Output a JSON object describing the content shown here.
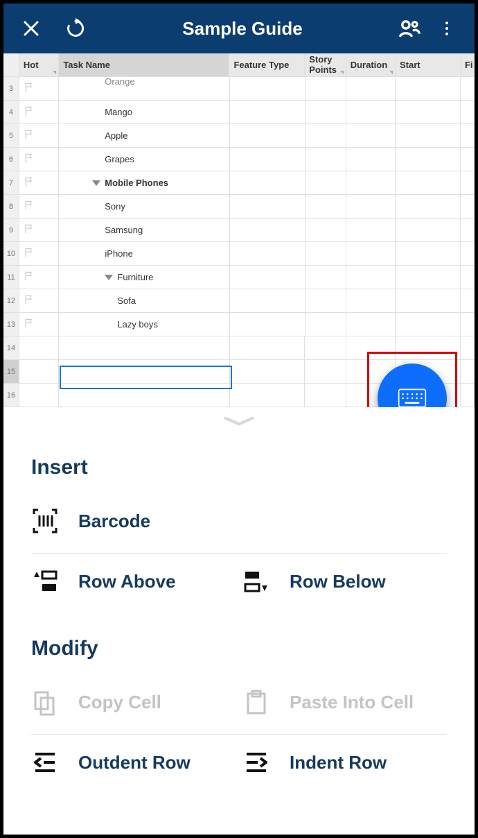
{
  "header": {
    "title": "Sample Guide"
  },
  "columns": {
    "hot": "Hot",
    "task_name": "Task Name",
    "feature_type": "Feature Type",
    "story_points": "Story Points",
    "duration": "Duration",
    "start": "Start",
    "fi": "Fi"
  },
  "rows": [
    {
      "num": "3",
      "indent": 3,
      "bold": false,
      "arrow": false,
      "label": "Orange",
      "cut": true
    },
    {
      "num": "4",
      "indent": 3,
      "bold": false,
      "arrow": false,
      "label": "Mango"
    },
    {
      "num": "5",
      "indent": 3,
      "bold": false,
      "arrow": false,
      "label": "Apple"
    },
    {
      "num": "6",
      "indent": 3,
      "bold": false,
      "arrow": false,
      "label": "Grapes"
    },
    {
      "num": "7",
      "indent": 2,
      "bold": true,
      "arrow": true,
      "label": "Mobile Phones"
    },
    {
      "num": "8",
      "indent": 3,
      "bold": false,
      "arrow": false,
      "label": "Sony"
    },
    {
      "num": "9",
      "indent": 3,
      "bold": false,
      "arrow": false,
      "label": "Samsung"
    },
    {
      "num": "10",
      "indent": 3,
      "bold": false,
      "arrow": false,
      "label": "iPhone"
    },
    {
      "num": "11",
      "indent": 3,
      "bold": false,
      "arrow": true,
      "label": "Furniture"
    },
    {
      "num": "12",
      "indent": 4,
      "bold": false,
      "arrow": false,
      "label": "Sofa"
    },
    {
      "num": "13",
      "indent": 4,
      "bold": false,
      "arrow": false,
      "label": "Lazy boys"
    },
    {
      "num": "14",
      "indent": 0,
      "bold": false,
      "arrow": false,
      "label": ""
    },
    {
      "num": "15",
      "indent": 0,
      "bold": false,
      "arrow": false,
      "label": ""
    },
    {
      "num": "16",
      "indent": 0,
      "bold": false,
      "arrow": false,
      "label": ""
    }
  ],
  "panel": {
    "insert_title": "Insert",
    "modify_title": "Modify",
    "barcode": "Barcode",
    "row_above": "Row Above",
    "row_below": "Row Below",
    "copy_cell": "Copy Cell",
    "paste_cell": "Paste Into Cell",
    "outdent": "Outdent Row",
    "indent": "Indent Row"
  }
}
